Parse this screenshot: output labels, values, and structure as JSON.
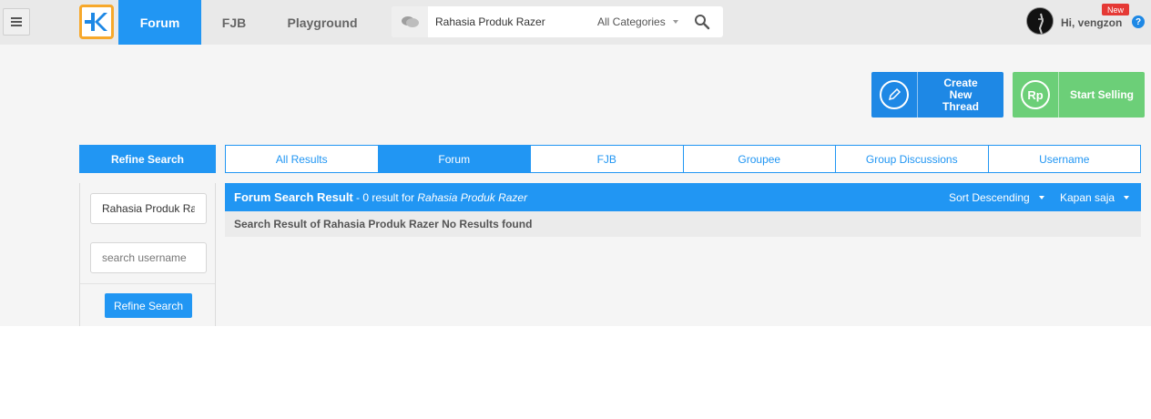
{
  "nav": {
    "tabs": [
      "Forum",
      "FJB",
      "Playground"
    ],
    "active_tab": "Forum"
  },
  "search": {
    "query": "Rahasia Produk Razer",
    "category": "All Categories"
  },
  "user": {
    "greeting": "Hi, vengzon",
    "new_badge": "New"
  },
  "actions": {
    "create_thread": "Create New Thread",
    "start_selling": "Start Selling"
  },
  "refine": {
    "heading": "Refine Search",
    "keyword_value": "Rahasia Produk Razer",
    "username_placeholder": "search username",
    "button": "Refine Search"
  },
  "result_tabs": [
    "All Results",
    "Forum",
    "FJB",
    "Groupee",
    "Group Discussions",
    "Username"
  ],
  "active_result_tab": "Forum",
  "results": {
    "title": "Forum Search Result",
    "meta_prefix": " - 0 result for ",
    "meta_query": "Rahasia Produk Razer",
    "sort": "Sort Descending",
    "time": "Kapan saja",
    "message": "Search Result of Rahasia Produk Razer No Results found"
  },
  "colors": {
    "primary": "#2196f3",
    "sell": "#6ccf78",
    "logo_border": "#f7a82b",
    "badge": "#e53935"
  },
  "icons": [
    "hamburger-icon",
    "kaskus-logo",
    "chat-bubble-icon",
    "search-icon",
    "pencil-icon",
    "rupiah-icon",
    "help-icon"
  ]
}
